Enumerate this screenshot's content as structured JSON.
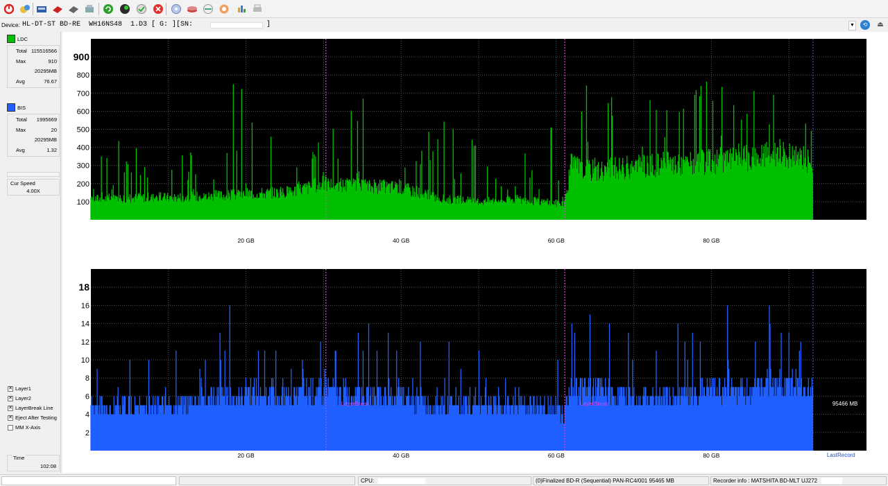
{
  "toolbar": {
    "buttons": [
      "power-icon",
      "open-icon",
      "drive-icon",
      "disc-red-icon",
      "disc-eject-icon",
      "burn-icon",
      "refresh-green-icon",
      "globe-icon",
      "disc-check-icon",
      "stop-icon",
      "shield-icon",
      "disc-stack-icon",
      "disc-scan-icon",
      "hand-icon",
      "chart-icon",
      "printer-icon"
    ]
  },
  "device": {
    "label": "Device:",
    "value": "HL-DT-ST BD-RE  WH16NS48  1.D3 [ G: ][SN:",
    "sn_close": "]"
  },
  "sidebar": {
    "ldc": {
      "label": "LDC",
      "color": "#00c000",
      "total_label": "Total",
      "total": "115516566",
      "max_label": "Max",
      "max": "910",
      "max_pos": "20295MB",
      "avg_label": "Avg",
      "avg": "76.67"
    },
    "bis": {
      "label": "BIS",
      "color": "#1f5fff",
      "total_label": "Total",
      "total": "1995669",
      "max_label": "Max",
      "max": "20",
      "max_pos": "20295MB",
      "avg_label": "Avg",
      "avg": "1.32"
    },
    "cur_speed_label": "Cur Speed",
    "cur_speed": "4.00X",
    "checks": [
      {
        "label": "Layer1",
        "checked": true
      },
      {
        "label": "Layer2",
        "checked": true
      },
      {
        "label": "LayerBreak Line",
        "checked": true
      },
      {
        "label": "Eject After Testing",
        "checked": true
      },
      {
        "label": "MM X-Axis",
        "checked": false
      }
    ],
    "time_label": "Time",
    "time": "102:08"
  },
  "chart_data": [
    {
      "type": "area",
      "series": [
        {
          "name": "LDC",
          "color": "#00c000"
        }
      ],
      "x_unit": "GB",
      "xlim": [
        0,
        100
      ],
      "ylim": [
        0,
        1000
      ],
      "x_ticks": [
        "20 GB",
        "40 GB",
        "60 GB",
        "80 GB"
      ],
      "x_tick_values": [
        20,
        40,
        60,
        80
      ],
      "y_ticks": [
        "100",
        "200",
        "300",
        "400",
        "500",
        "600",
        "700",
        "800",
        "900"
      ],
      "y_tick_values": [
        100,
        200,
        300,
        400,
        500,
        600,
        700,
        800,
        900
      ],
      "x": [
        0,
        5,
        10,
        15,
        19.5,
        20,
        25,
        30,
        35,
        40,
        45,
        50,
        55,
        60,
        61,
        62,
        65,
        70,
        75,
        80,
        85,
        88.5,
        93.1
      ],
      "baseline": [
        120,
        125,
        128,
        135,
        145,
        150,
        155,
        205,
        190,
        185,
        120,
        105,
        115,
        95,
        90,
        310,
        280,
        300,
        320,
        330,
        350,
        380,
        330
      ],
      "peaks": [
        330,
        480,
        510,
        420,
        910,
        560,
        440,
        470,
        690,
        460,
        610,
        420,
        330,
        560,
        310,
        730,
        810,
        650,
        690,
        780,
        700,
        890,
        520
      ],
      "layer_breaks": [
        30.3,
        61.1
      ],
      "end_x": 93.1,
      "grid": true
    },
    {
      "type": "area",
      "series": [
        {
          "name": "BIS",
          "color": "#1f5fff"
        }
      ],
      "x_unit": "GB",
      "xlim": [
        0,
        100
      ],
      "ylim": [
        0,
        20
      ],
      "x_ticks": [
        "20 GB",
        "40 GB",
        "60 GB",
        "80 GB"
      ],
      "x_tick_values": [
        20,
        40,
        60,
        80
      ],
      "y_ticks": [
        "2",
        "4",
        "6",
        "8",
        "10",
        "12",
        "14",
        "16",
        "18"
      ],
      "y_tick_values": [
        2,
        4,
        6,
        8,
        10,
        12,
        14,
        16,
        18
      ],
      "x": [
        0,
        5,
        10,
        15,
        19.5,
        20,
        25,
        30,
        35,
        40,
        45,
        50,
        55,
        60,
        61,
        62,
        65,
        70,
        75,
        80,
        85,
        88.5,
        93.1
      ],
      "baseline": [
        5,
        5,
        5,
        6,
        6,
        7,
        6,
        7,
        6,
        6,
        5,
        5,
        5,
        5,
        4,
        7,
        7,
        6,
        6,
        7,
        7,
        8,
        7
      ],
      "peaks": [
        10,
        11,
        12,
        11,
        20,
        13,
        11,
        12,
        15,
        12,
        13,
        11,
        11,
        12,
        8,
        14,
        16,
        13,
        14,
        17,
        15,
        18,
        12
      ],
      "layer_breaks": [
        30.3,
        61.1
      ],
      "layer_break_label": "LayerBreak",
      "end_x": 93.1,
      "end_label": "95466 MB",
      "last_record_label": "LastRecord",
      "grid": true
    }
  ],
  "status": {
    "cpu_label": "CPU:",
    "disc_info": "(0)Finalized  BD-R (Sequential)  PAN-RC4/001  95465 MB",
    "recorder_info": "Recorder info : MATSHITA      BD-MLT UJ272"
  }
}
